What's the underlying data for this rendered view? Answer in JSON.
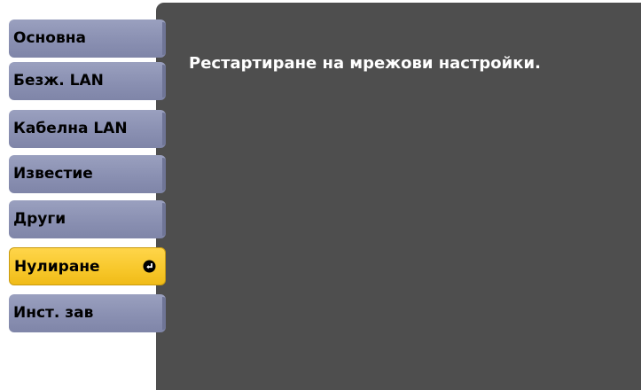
{
  "menu": {
    "items": [
      {
        "label": "Основна"
      },
      {
        "label": "Безж. LAN"
      },
      {
        "label": "Кабелна LAN"
      },
      {
        "label": "Известие"
      },
      {
        "label": "Други"
      },
      {
        "label": "Нулиране",
        "selected": true,
        "icon": "enter-icon"
      },
      {
        "label": "Инст. зав"
      }
    ]
  },
  "panel": {
    "message": "Рестартиране на мрежови настройки."
  },
  "colors": {
    "tab": "#8a90b2",
    "active_tab": "#f7c72a",
    "panel": "#4e4e4e",
    "panel_text": "#ffffff"
  }
}
